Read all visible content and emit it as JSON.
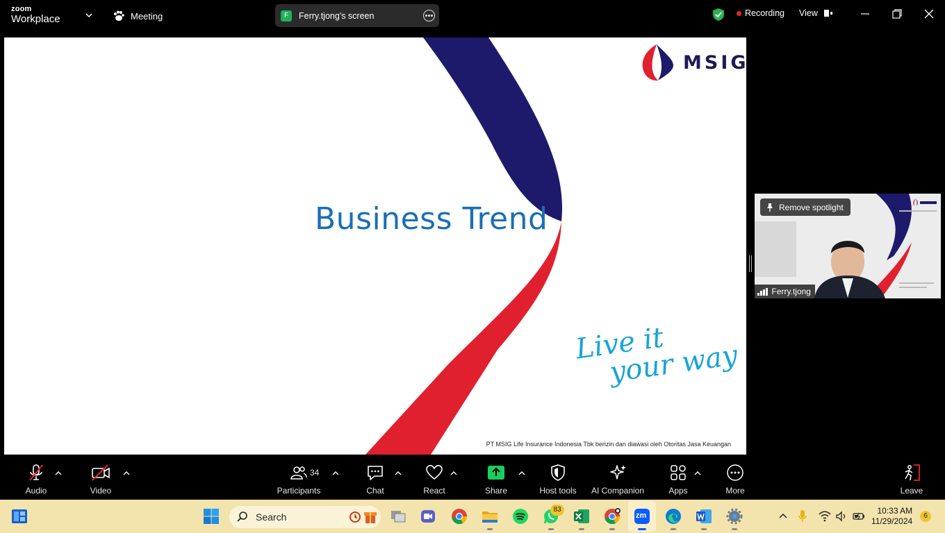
{
  "app": {
    "brand_line1": "zoom",
    "brand_line2": "Workplace"
  },
  "titlebar": {
    "meeting_label": "Meeting",
    "share_avatar_letter": "F",
    "share_label": "Ferry.tjong's screen",
    "recording_label": "Recording",
    "view_label": "View"
  },
  "slide": {
    "title": "Business Trend",
    "brand": "MSIG",
    "tagline_line1": "Live it",
    "tagline_line2": "your way",
    "footer": "PT MSIG Life Insurance Indonesia Tbk berizin dan diawasi oleh Otoritas Jasa Keuangan",
    "colors": {
      "navy": "#1e1a6b",
      "red": "#e0202e",
      "title": "#1a6fb5",
      "tagline": "#16a4d8"
    }
  },
  "tile": {
    "spotlight_label": "Remove spotlight",
    "participant_name": "Ferry.tjong"
  },
  "toolbar": {
    "audio": "Audio",
    "video": "Video",
    "participants": "Participants",
    "participants_count": "34",
    "chat": "Chat",
    "react": "React",
    "share": "Share",
    "host_tools": "Host tools",
    "ai_companion": "AI Companion",
    "apps": "Apps",
    "more": "More",
    "leave": "Leave"
  },
  "taskbar": {
    "search_placeholder": "Search",
    "whatsapp_badge": "83",
    "time": "10:33 AM",
    "date": "11/29/2024",
    "notification_count": "6",
    "zoom_label": "zm",
    "background": "#f3e4ae"
  }
}
